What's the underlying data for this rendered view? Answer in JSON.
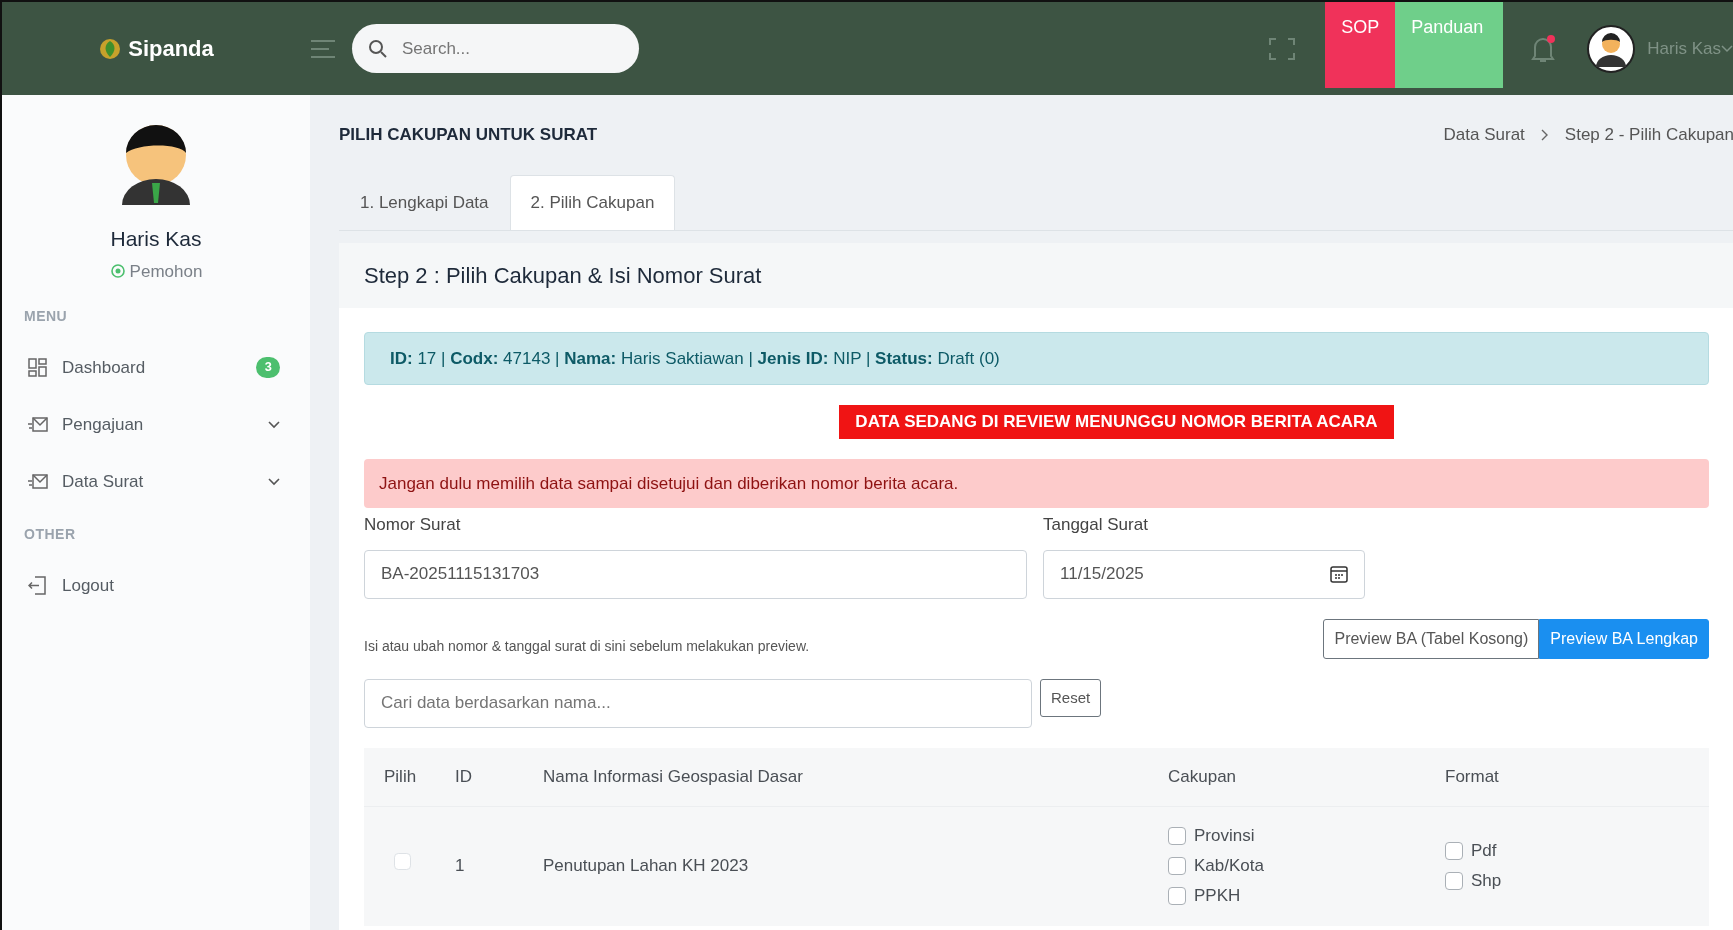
{
  "header": {
    "brand": "Sipanda",
    "search": {
      "placeholder": "Search..."
    },
    "buttons": [
      {
        "label": "SOP",
        "kind": "danger"
      },
      {
        "label": "Panduan",
        "kind": "success"
      }
    ],
    "notification": {
      "unread": true
    },
    "user": "Haris Kas"
  },
  "sidebar": {
    "profile": {
      "name": "Haris Kas",
      "role": "Pemohon"
    },
    "sections": [
      {
        "heading": "MENU",
        "items": [
          {
            "label": "Dashboard",
            "kind": "dashboard",
            "badge": "3",
            "expandable": false
          },
          {
            "label": "Pengajuan",
            "kind": "mail",
            "expandable": true
          },
          {
            "label": "Data Surat",
            "kind": "mail",
            "expandable": true
          }
        ]
      },
      {
        "heading": "OTHER",
        "items": [
          {
            "label": "Logout",
            "kind": "logout",
            "expandable": false
          }
        ]
      }
    ]
  },
  "content": {
    "page_title": "PILIH CAKUPAN UNTUK SURAT",
    "breadcrumb": [
      "Data Surat",
      "Step 2 - Pilih Cakupan"
    ],
    "tabs": [
      {
        "label": "1. Lengkapi Data",
        "selected": false
      },
      {
        "label": "2. Pilih Cakupan",
        "selected": true
      }
    ],
    "card_title": "Step 2 : Pilih Cakupan & Isi Nomor Surat",
    "info": "**ID:** 17 | **Codx:** 47143 | **Nama:** Haris Saktiawan | **Jenis ID:** NIP | **Status:** Draft (0)",
    "review_banner": "DATA SEDANG DI REVIEW MENUNGGU NOMOR BERITA ACARA",
    "warning": "Jangan dulu memilih data sampai disetujui dan diberikan nomor berita acara.",
    "nomor_surat": {
      "label": "Nomor Surat",
      "value": "BA-20251115131703"
    },
    "tanggal_surat": {
      "label": "Tanggal Surat",
      "value": "11/15/2025"
    },
    "hint": "Isi atau ubah nomor & tanggal surat di sini sebelum melakukan preview.",
    "preview_buttons": [
      {
        "label": "Preview BA (Tabel Kosong)",
        "kind": "outline"
      },
      {
        "label": "Preview BA Lengkap",
        "kind": "primary"
      }
    ],
    "filter": {
      "placeholder": "Cari data berdasarkan nama...",
      "reset": "Reset"
    },
    "table": {
      "columns": [
        "Pilih",
        "ID",
        "Nama Informasi Geospasial Dasar",
        "Cakupan",
        "Format"
      ],
      "rows": [
        {
          "checked": false,
          "id": "1",
          "name": "Penutupan Lahan KH 2023",
          "cakupan": [
            {
              "label": "Provinsi",
              "checked": false
            },
            {
              "label": "Kab/Kota",
              "checked": false
            },
            {
              "label": "PPKH",
              "checked": false
            }
          ],
          "format": [
            {
              "label": "Pdf",
              "checked": false
            },
            {
              "label": "Shp",
              "checked": false
            }
          ]
        }
      ]
    }
  }
}
